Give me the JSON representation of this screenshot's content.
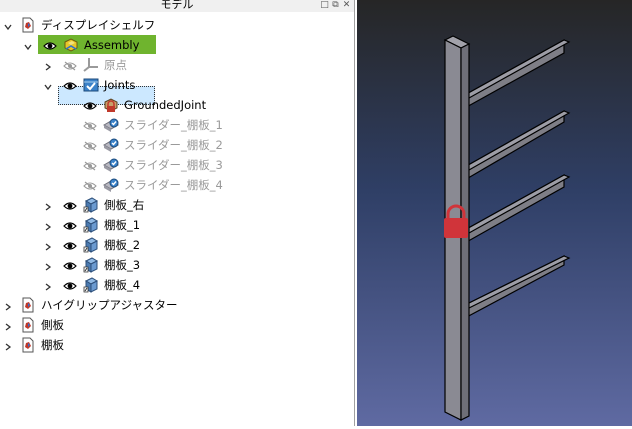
{
  "panel": {
    "title": "モデル"
  },
  "tree": [
    {
      "label": "ディスプレイシェルフ",
      "indent": 0,
      "expanded": true,
      "has_arrow": true,
      "eye": "none",
      "icon": "document-icon",
      "grey": false
    },
    {
      "label": "Assembly",
      "indent": 1,
      "expanded": true,
      "has_arrow": true,
      "eye": "visible",
      "icon": "assembly-icon",
      "grey": false
    },
    {
      "label": "原点",
      "indent": 2,
      "expanded": false,
      "has_arrow": true,
      "eye": "hidden",
      "icon": "origin-icon",
      "grey": true
    },
    {
      "label": "Joints",
      "indent": 2,
      "expanded": true,
      "has_arrow": true,
      "eye": "visible",
      "icon": "joints-icon",
      "grey": false
    },
    {
      "label": "GroundedJoint",
      "indent": 3,
      "expanded": false,
      "has_arrow": false,
      "eye": "visible",
      "icon": "grounded-joint-icon",
      "grey": false
    },
    {
      "label": "スライダー_棚板_1",
      "indent": 3,
      "expanded": false,
      "has_arrow": false,
      "eye": "hidden",
      "icon": "slider-joint-icon",
      "grey": true
    },
    {
      "label": "スライダー_棚板_2",
      "indent": 3,
      "expanded": false,
      "has_arrow": false,
      "eye": "hidden",
      "icon": "slider-joint-icon",
      "grey": true
    },
    {
      "label": "スライダー_棚板_3",
      "indent": 3,
      "expanded": false,
      "has_arrow": false,
      "eye": "hidden",
      "icon": "slider-joint-icon",
      "grey": true
    },
    {
      "label": "スライダー_棚板_4",
      "indent": 3,
      "expanded": false,
      "has_arrow": false,
      "eye": "hidden",
      "icon": "slider-joint-icon",
      "grey": true
    },
    {
      "label": "側板_右",
      "indent": 2,
      "expanded": false,
      "has_arrow": true,
      "eye": "visible",
      "icon": "part-link-icon",
      "grey": false
    },
    {
      "label": "棚板_1",
      "indent": 2,
      "expanded": false,
      "has_arrow": true,
      "eye": "visible",
      "icon": "part-link-icon",
      "grey": false
    },
    {
      "label": "棚板_2",
      "indent": 2,
      "expanded": false,
      "has_arrow": true,
      "eye": "visible",
      "icon": "part-link-icon",
      "grey": false
    },
    {
      "label": "棚板_3",
      "indent": 2,
      "expanded": false,
      "has_arrow": true,
      "eye": "visible",
      "icon": "part-link-icon",
      "grey": false
    },
    {
      "label": "棚板_4",
      "indent": 2,
      "expanded": false,
      "has_arrow": true,
      "eye": "visible",
      "icon": "part-link-icon",
      "grey": false
    },
    {
      "label": "ハイグリップアジャスター",
      "indent": 0,
      "expanded": false,
      "has_arrow": true,
      "eye": "none",
      "icon": "document-icon",
      "grey": false
    },
    {
      "label": "側板",
      "indent": 0,
      "expanded": false,
      "has_arrow": true,
      "eye": "none",
      "icon": "document-icon",
      "grey": false
    },
    {
      "label": "棚板",
      "indent": 0,
      "expanded": false,
      "has_arrow": true,
      "eye": "none",
      "icon": "document-icon",
      "grey": false
    }
  ],
  "colors": {
    "assembly_highlight": "#6fb42e",
    "joints_selection": "#cce8ff",
    "shelf_face": "#8d8d96",
    "lock_red": "#d0343a"
  }
}
